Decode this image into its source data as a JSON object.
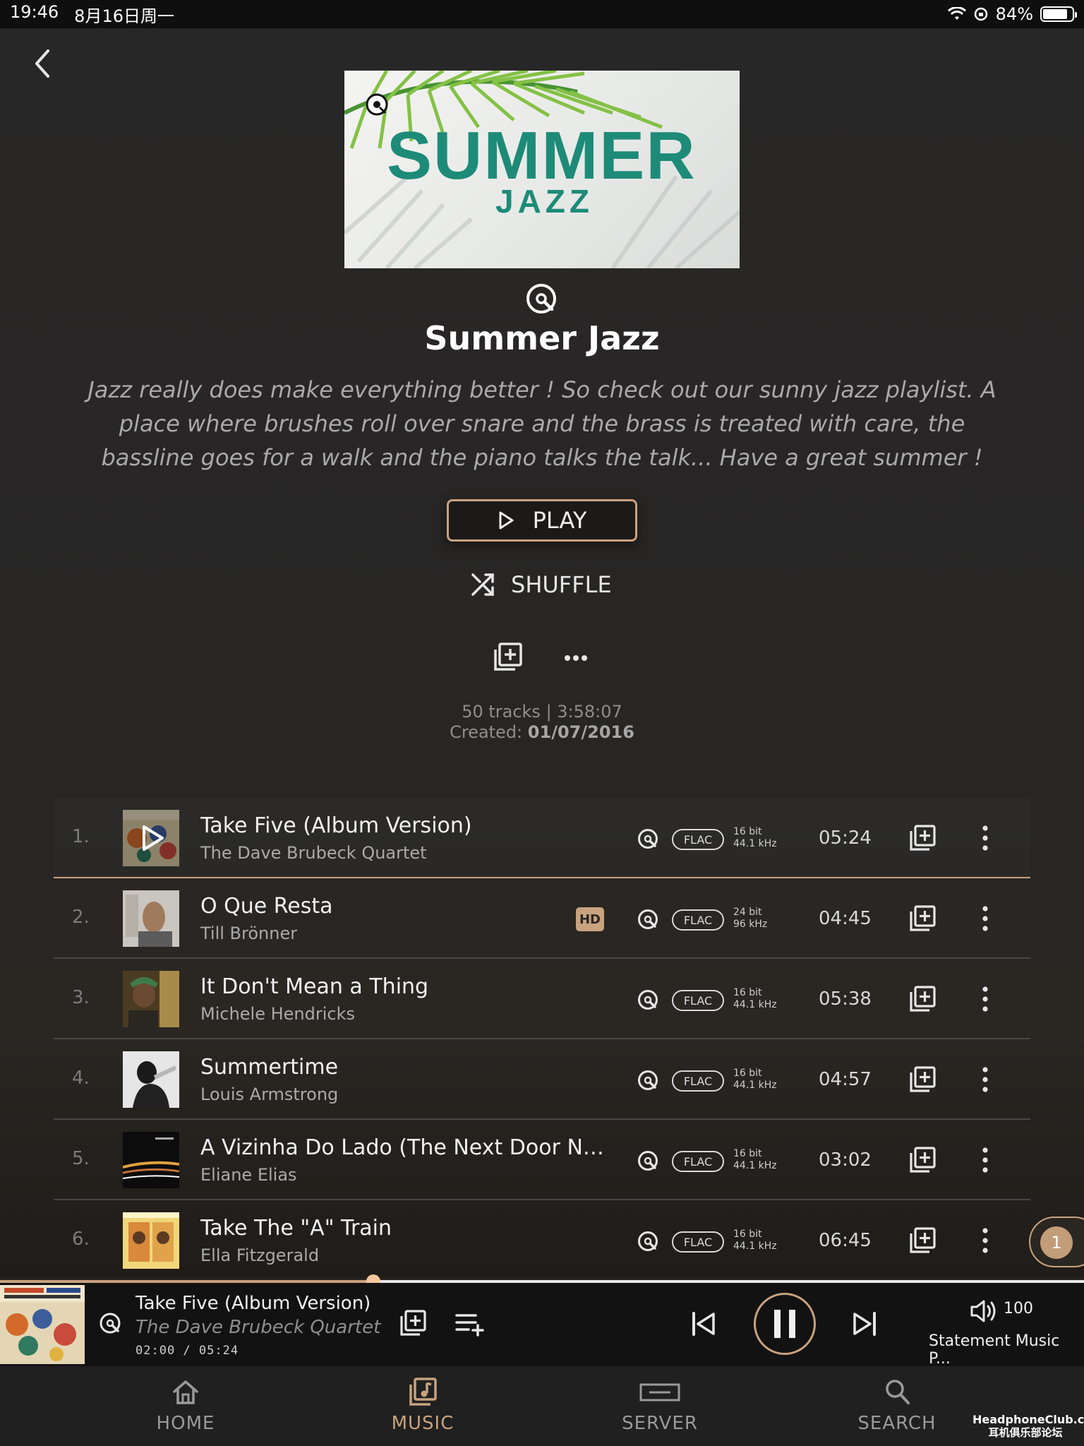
{
  "status_bar": {
    "time": "19:46",
    "date": "8月16日周一",
    "battery": "84%",
    "battery_level": 0.84
  },
  "playlist": {
    "cover_title": "SUMMER",
    "cover_subtitle": "JAZZ",
    "title": "Summer Jazz",
    "description": "Jazz really does make everything better ! So check out our sunny jazz playlist. A place where brushes roll over snare and the brass is treated with care, the bassline goes for a walk and the piano talks the talk... Have a great summer !",
    "play_label": "PLAY",
    "shuffle_label": "SHUFFLE",
    "tracks_summary": "50 tracks | 3:58:07",
    "created_label": "Created:",
    "created_date": "01/07/2016"
  },
  "tracks": [
    {
      "num": "1.",
      "title": "Take Five (Album Version)",
      "artist": "The Dave Brubeck Quartet",
      "format": "FLAC",
      "bits": "16 bit",
      "rate": "44.1 kHz",
      "duration": "05:24",
      "hd": false,
      "playing": true
    },
    {
      "num": "2.",
      "title": "O Que Resta",
      "artist": "Till Brönner",
      "format": "FLAC",
      "bits": "24 bit",
      "rate": "96 kHz",
      "duration": "04:45",
      "hd": true,
      "hd_label": "HD"
    },
    {
      "num": "3.",
      "title": "It Don't Mean a Thing",
      "artist": "Michele Hendricks",
      "format": "FLAC",
      "bits": "16 bit",
      "rate": "44.1 kHz",
      "duration": "05:38",
      "hd": false
    },
    {
      "num": "4.",
      "title": "Summertime",
      "artist": "Louis Armstrong",
      "format": "FLAC",
      "bits": "16 bit",
      "rate": "44.1 kHz",
      "duration": "04:57",
      "hd": false
    },
    {
      "num": "5.",
      "title": "A Vizinha Do Lado (The Next Door Neig...",
      "artist": "Eliane Elias",
      "format": "FLAC",
      "bits": "16 bit",
      "rate": "44.1 kHz",
      "duration": "03:02",
      "hd": false
    },
    {
      "num": "6.",
      "title": "Take The \"A\" Train",
      "artist": "Ella Fitzgerald",
      "format": "FLAC",
      "bits": "16 bit",
      "rate": "44.1 kHz",
      "duration": "06:45",
      "hd": false
    }
  ],
  "queue_count": "1",
  "now_playing": {
    "title": "Take Five (Album Version)",
    "artist": "The Dave Brubeck Quartet",
    "time": "02:00 / 05:24",
    "progress": 0.3704,
    "volume": "100",
    "device": "Statement Music P..."
  },
  "tabs": [
    {
      "label": "HOME",
      "icon": "home-icon"
    },
    {
      "label": "MUSIC",
      "icon": "music-library-icon",
      "active": true
    },
    {
      "label": "SERVER",
      "icon": "server-icon"
    },
    {
      "label": "SEARCH",
      "icon": "search-icon"
    }
  ],
  "watermark": {
    "line1": "HeadphoneClub.com",
    "line2": "耳机俱乐部论坛"
  },
  "colors": {
    "accent": "#c9a27e",
    "background": "#252423",
    "flac_cover_green": "#1d8b78"
  }
}
